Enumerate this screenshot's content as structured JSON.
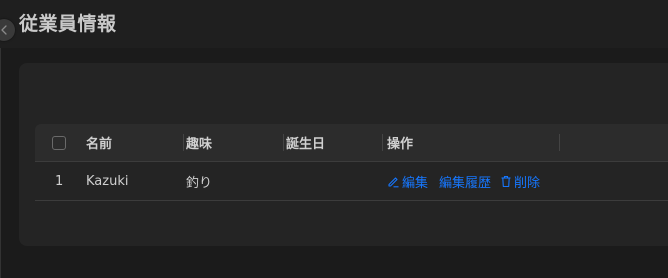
{
  "header": {
    "title": "従業員情報"
  },
  "table": {
    "columns": {
      "name": "名前",
      "hobby": "趣味",
      "birthday": "誕生日",
      "actions": "操作"
    },
    "rows": [
      {
        "index": "1",
        "name": "Kazuki",
        "hobby": "釣り",
        "birthday": ""
      }
    ],
    "actions": {
      "edit": "編集",
      "history": "編集履歴",
      "delete": "削除"
    }
  },
  "colors": {
    "link": "#1677ff",
    "background": "#1a1a1a",
    "card": "#242424",
    "table_header": "#2c2c2c"
  },
  "icons": {
    "collapse": "chevron-left-icon",
    "edit": "pencil-icon",
    "delete": "trash-icon"
  }
}
